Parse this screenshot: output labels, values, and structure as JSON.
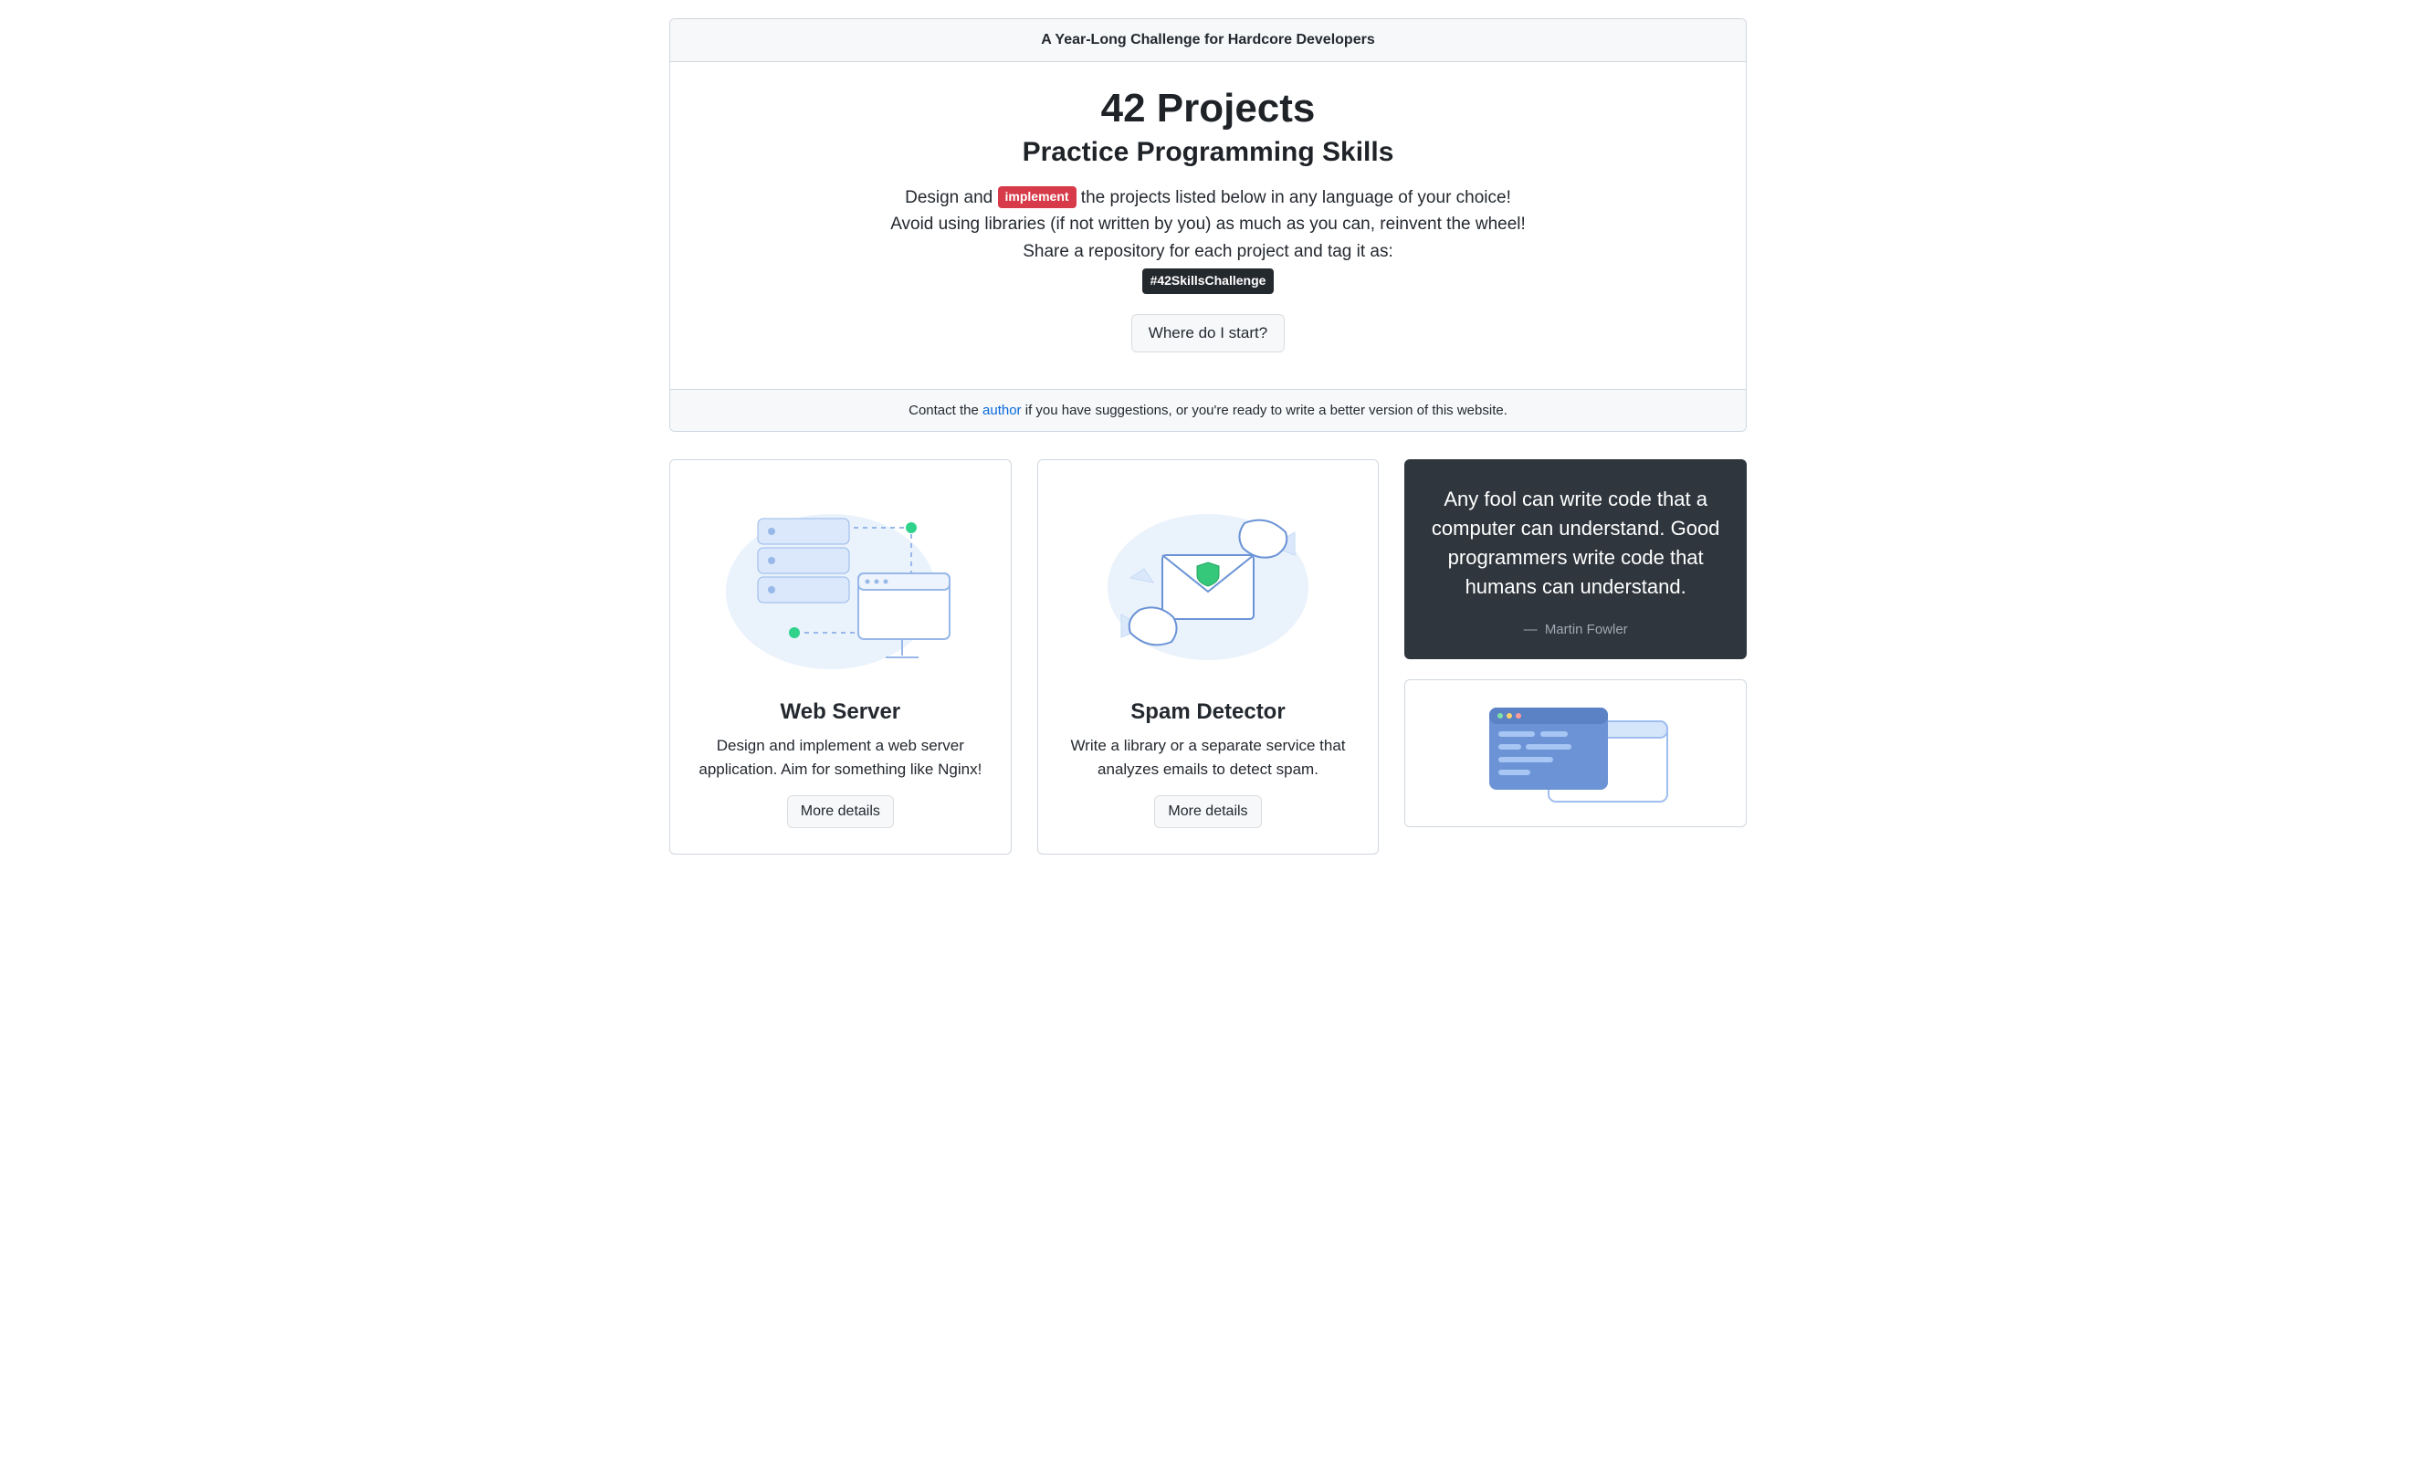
{
  "header": {
    "tagline": "A Year-Long Challenge for Hardcore Developers"
  },
  "hero": {
    "title": "42 Projects",
    "subtitle": "Practice Programming Skills",
    "line1a": "Design and ",
    "implement_label": "implement",
    "line1b": " the projects listed below in any language of your choice!",
    "line2": "Avoid using libraries (if not written by you) as much as you can, reinvent the wheel!",
    "line3": "Share a repository for each project and tag it as:",
    "hashtag": "#42SkillsChallenge",
    "cta": "Where do I start?"
  },
  "footer": {
    "pre": "Contact the ",
    "link": "author",
    "post": " if you have suggestions, or you're ready to write a better version of this website."
  },
  "projects": [
    {
      "title": "Web Server",
      "desc": "Design and implement a web server application. Aim for something like Nginx!",
      "button": "More details"
    },
    {
      "title": "Spam Detector",
      "desc": "Write a library or a separate service that analyzes emails to detect spam.",
      "button": "More details"
    }
  ],
  "quote": {
    "text": "Any fool can write code that a computer can understand. Good programmers write code that humans can understand.",
    "author": "Martin Fowler"
  }
}
